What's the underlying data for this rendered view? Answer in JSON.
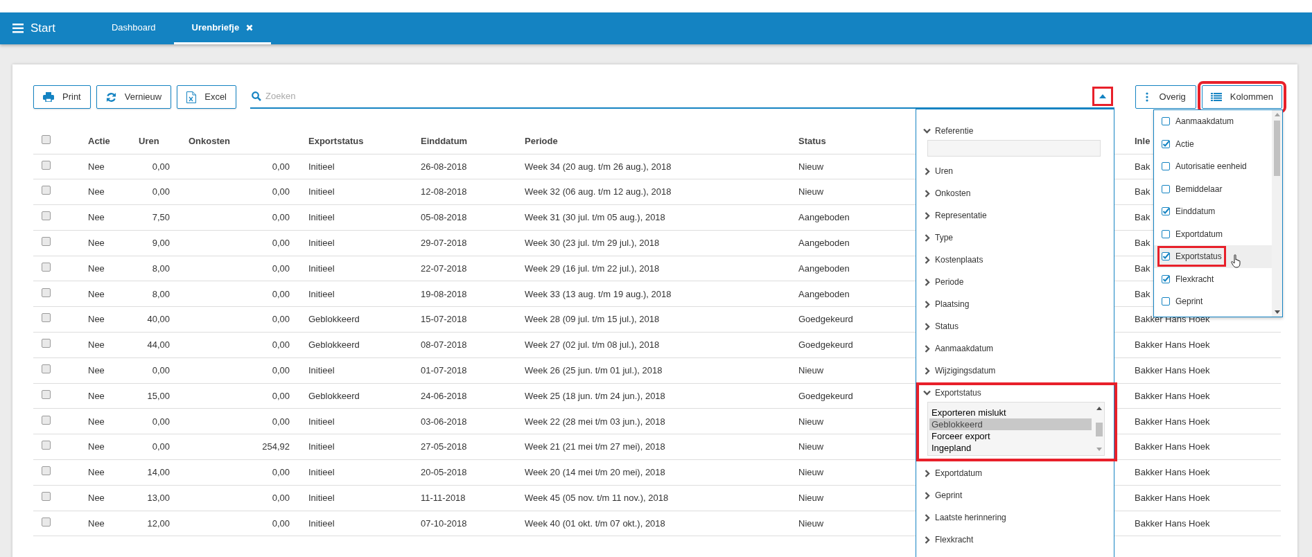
{
  "app_bar": {
    "menu_label": "Start",
    "tabs": [
      {
        "label": "Dashboard",
        "selected": false,
        "closable": false
      },
      {
        "label": "Urenbriefje",
        "selected": true,
        "closable": true
      }
    ]
  },
  "toolbar": {
    "buttons": [
      {
        "kind": "print",
        "label": "Print"
      },
      {
        "kind": "refresh",
        "label": "Vernieuw"
      },
      {
        "kind": "excel",
        "label": "Excel"
      }
    ],
    "search": {
      "placeholder": "Zoeken"
    },
    "filter_toggle": {
      "expanded": true,
      "highlighted": true
    },
    "more_button": {
      "label": "Overig"
    },
    "columns_button": {
      "label": "Kolommen",
      "highlighted": true
    }
  },
  "table": {
    "select_all": {
      "checked": false
    },
    "columns": [
      "Actie",
      "Uren",
      "Onkosten",
      "Exportstatus",
      "Einddatum",
      "Periode",
      "Status",
      "Inle"
    ],
    "rows": [
      {
        "checked": false,
        "cells": [
          "Nee",
          "0,00",
          "0,00",
          "Initieel",
          "26-08-2018",
          "Week 34 (20 aug. t/m 26 aug.), 2018",
          "Nieuw",
          "Bak"
        ]
      },
      {
        "checked": false,
        "cells": [
          "Nee",
          "0,00",
          "0,00",
          "Initieel",
          "12-08-2018",
          "Week 32 (06 aug. t/m 12 aug.), 2018",
          "Nieuw",
          "Bak"
        ]
      },
      {
        "checked": false,
        "cells": [
          "Nee",
          "7,50",
          "0,00",
          "Initieel",
          "05-08-2018",
          "Week 31 (30 jul. t/m 05 aug.), 2018",
          "Aangeboden",
          "Bak"
        ]
      },
      {
        "checked": false,
        "cells": [
          "Nee",
          "9,00",
          "0,00",
          "Initieel",
          "29-07-2018",
          "Week 30 (23 jul. t/m 29 jul.), 2018",
          "Aangeboden",
          "Bak"
        ]
      },
      {
        "checked": false,
        "cells": [
          "Nee",
          "8,00",
          "0,00",
          "Initieel",
          "22-07-2018",
          "Week 29 (16 jul. t/m 22 jul.), 2018",
          "Aangeboden",
          "Bak"
        ]
      },
      {
        "checked": false,
        "cells": [
          "Nee",
          "8,00",
          "0,00",
          "Initieel",
          "19-08-2018",
          "Week 33 (13 aug. t/m 19 aug.), 2018",
          "Aangeboden",
          "Bak"
        ]
      },
      {
        "checked": false,
        "cells": [
          "Nee",
          "40,00",
          "0,00",
          "Geblokkeerd",
          "15-07-2018",
          "Week 28 (09 jul. t/m 15 jul.), 2018",
          "Goedgekeurd",
          "Bakker Hans Hoek"
        ]
      },
      {
        "checked": false,
        "cells": [
          "Nee",
          "44,00",
          "0,00",
          "Geblokkeerd",
          "08-07-2018",
          "Week 27 (02 jul. t/m 08 jul.), 2018",
          "Goedgekeurd",
          "Bakker Hans Hoek"
        ]
      },
      {
        "checked": false,
        "cells": [
          "Nee",
          "0,00",
          "0,00",
          "Initieel",
          "01-07-2018",
          "Week 26 (25 jun. t/m 01 jul.), 2018",
          "Nieuw",
          "Bakker Hans Hoek"
        ]
      },
      {
        "checked": false,
        "cells": [
          "Nee",
          "15,00",
          "0,00",
          "Geblokkeerd",
          "24-06-2018",
          "Week 25 (18 jun. t/m 24 jun.), 2018",
          "Goedgekeurd",
          "Bakker Hans Hoek"
        ]
      },
      {
        "checked": false,
        "cells": [
          "Nee",
          "0,00",
          "0,00",
          "Initieel",
          "03-06-2018",
          "Week 22 (28 mei t/m 03 jun.), 2018",
          "Nieuw",
          "Bakker Hans Hoek"
        ]
      },
      {
        "checked": false,
        "cells": [
          "Nee",
          "0,00",
          "254,92",
          "Initieel",
          "27-05-2018",
          "Week 21 (21 mei t/m 27 mei), 2018",
          "Nieuw",
          "Bakker Hans Hoek"
        ]
      },
      {
        "checked": false,
        "cells": [
          "Nee",
          "14,00",
          "0,00",
          "Initieel",
          "20-05-2018",
          "Week 20 (14 mei t/m 20 mei), 2018",
          "Nieuw",
          "Bakker Hans Hoek"
        ]
      },
      {
        "checked": false,
        "cells": [
          "Nee",
          "13,00",
          "0,00",
          "Initieel",
          "11-11-2018",
          "Week 45 (05 nov. t/m 11 nov.), 2018",
          "Nieuw",
          "Bakker Hans Hoek"
        ]
      },
      {
        "checked": false,
        "cells": [
          "Nee",
          "12,00",
          "0,00",
          "Initieel",
          "07-10-2018",
          "Week 40 (01 okt. t/m 07 okt.), 2018",
          "Nieuw",
          "Bakker Hans Hoek"
        ]
      }
    ]
  },
  "filter_panel": {
    "sections": [
      {
        "label": "Referentie",
        "expanded": true,
        "highlighted": false,
        "kind": "text"
      },
      {
        "label": "Uren",
        "expanded": false,
        "highlighted": false
      },
      {
        "label": "Onkosten",
        "expanded": false,
        "highlighted": false
      },
      {
        "label": "Representatie",
        "expanded": false,
        "highlighted": false
      },
      {
        "label": "Type",
        "expanded": false,
        "highlighted": false
      },
      {
        "label": "Kostenplaats",
        "expanded": false,
        "highlighted": false
      },
      {
        "label": "Periode",
        "expanded": false,
        "highlighted": false
      },
      {
        "label": "Plaatsing",
        "expanded": false,
        "highlighted": false
      },
      {
        "label": "Status",
        "expanded": false,
        "highlighted": false
      },
      {
        "label": "Aanmaakdatum",
        "expanded": false,
        "highlighted": false
      },
      {
        "label": "Wijzigingsdatum",
        "expanded": false,
        "highlighted": false
      },
      {
        "label": "Exportstatus",
        "expanded": true,
        "highlighted": true,
        "kind": "list",
        "options": [
          {
            "label": "Exporteren mislukt",
            "selected": false
          },
          {
            "label": "Geblokkeerd",
            "selected": true
          },
          {
            "label": "Forceer export",
            "selected": false
          },
          {
            "label": "Ingepland",
            "selected": false
          }
        ]
      },
      {
        "label": "Exportdatum",
        "expanded": false,
        "highlighted": false
      },
      {
        "label": "Geprint",
        "expanded": false,
        "highlighted": false
      },
      {
        "label": "Laatste herinnering",
        "expanded": false,
        "highlighted": false
      },
      {
        "label": "Flexkracht",
        "expanded": false,
        "highlighted": false
      }
    ]
  },
  "columns_menu": {
    "items": [
      {
        "label": "Aanmaakdatum",
        "checked": false,
        "hovered": false,
        "highlighted": false
      },
      {
        "label": "Actie",
        "checked": true,
        "hovered": false,
        "highlighted": false
      },
      {
        "label": "Autorisatie eenheid",
        "checked": false,
        "hovered": false,
        "highlighted": false
      },
      {
        "label": "Bemiddelaar",
        "checked": false,
        "hovered": false,
        "highlighted": false
      },
      {
        "label": "Einddatum",
        "checked": true,
        "hovered": false,
        "highlighted": false
      },
      {
        "label": "Exportdatum",
        "checked": false,
        "hovered": false,
        "highlighted": false
      },
      {
        "label": "Exportstatus",
        "checked": true,
        "hovered": true,
        "highlighted": true
      },
      {
        "label": "Flexkracht",
        "checked": true,
        "hovered": false,
        "highlighted": false
      },
      {
        "label": "Geprint",
        "checked": false,
        "hovered": false,
        "highlighted": false
      }
    ]
  }
}
